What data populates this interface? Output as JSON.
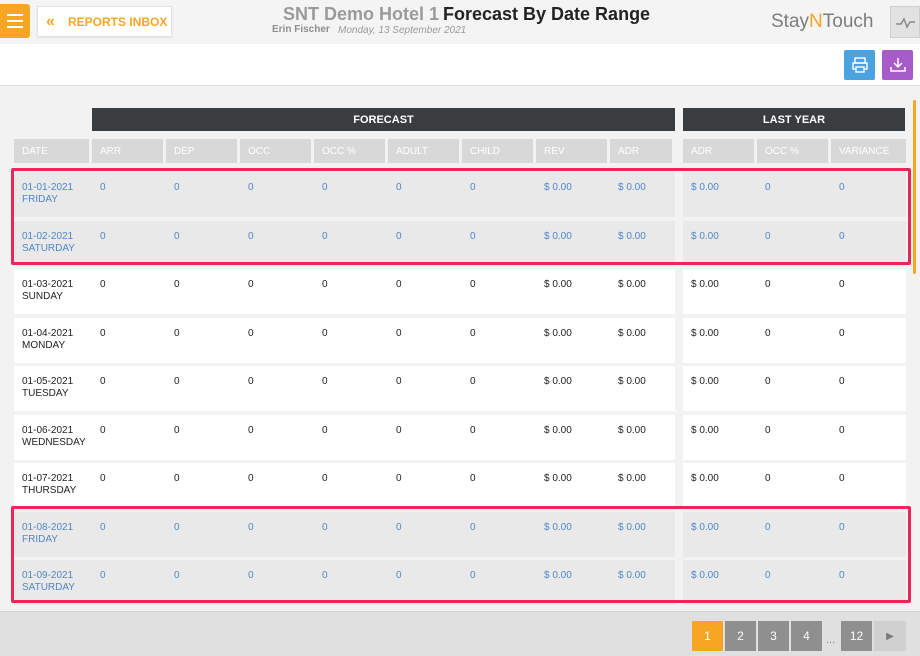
{
  "header": {
    "back_label": "REPORTS INBOX",
    "hotel_name": "SNT Demo Hotel 1",
    "report_title": "Forecast By Date Range",
    "user_name": "Erin Fischer",
    "date": "Monday, 13 September 2021",
    "logo_stay": "Stay",
    "logo_n": "N",
    "logo_touch": "Touch"
  },
  "groups": {
    "forecast": "FORECAST",
    "last_year": "LAST YEAR"
  },
  "columns": [
    "DATE",
    "ARR",
    "DEP",
    "OCC",
    "OCC %",
    "ADULT",
    "CHILD",
    "REV",
    "ADR",
    "ADR",
    "OCC %",
    "VARIANCE"
  ],
  "rows": [
    {
      "date": "01-01-2021",
      "day": "FRIDAY",
      "arr": "0",
      "dep": "0",
      "occ": "0",
      "occ_pct": "0",
      "adult": "0",
      "child": "0",
      "rev": "$ 0.00",
      "adr": "$ 0.00",
      "ly_adr": "$ 0.00",
      "ly_occ_pct": "0",
      "variance": "0"
    },
    {
      "date": "01-02-2021",
      "day": "SATURDAY",
      "arr": "0",
      "dep": "0",
      "occ": "0",
      "occ_pct": "0",
      "adult": "0",
      "child": "0",
      "rev": "$ 0.00",
      "adr": "$ 0.00",
      "ly_adr": "$ 0.00",
      "ly_occ_pct": "0",
      "variance": "0"
    },
    {
      "date": "01-03-2021",
      "day": "SUNDAY",
      "arr": "0",
      "dep": "0",
      "occ": "0",
      "occ_pct": "0",
      "adult": "0",
      "child": "0",
      "rev": "$ 0.00",
      "adr": "$ 0.00",
      "ly_adr": "$ 0.00",
      "ly_occ_pct": "0",
      "variance": "0"
    },
    {
      "date": "01-04-2021",
      "day": "MONDAY",
      "arr": "0",
      "dep": "0",
      "occ": "0",
      "occ_pct": "0",
      "adult": "0",
      "child": "0",
      "rev": "$ 0.00",
      "adr": "$ 0.00",
      "ly_adr": "$ 0.00",
      "ly_occ_pct": "0",
      "variance": "0"
    },
    {
      "date": "01-05-2021",
      "day": "TUESDAY",
      "arr": "0",
      "dep": "0",
      "occ": "0",
      "occ_pct": "0",
      "adult": "0",
      "child": "0",
      "rev": "$ 0.00",
      "adr": "$ 0.00",
      "ly_adr": "$ 0.00",
      "ly_occ_pct": "0",
      "variance": "0"
    },
    {
      "date": "01-06-2021",
      "day": "WEDNESDAY",
      "arr": "0",
      "dep": "0",
      "occ": "0",
      "occ_pct": "0",
      "adult": "0",
      "child": "0",
      "rev": "$ 0.00",
      "adr": "$ 0.00",
      "ly_adr": "$ 0.00",
      "ly_occ_pct": "0",
      "variance": "0"
    },
    {
      "date": "01-07-2021",
      "day": "THURSDAY",
      "arr": "0",
      "dep": "0",
      "occ": "0",
      "occ_pct": "0",
      "adult": "0",
      "child": "0",
      "rev": "$ 0.00",
      "adr": "$ 0.00",
      "ly_adr": "$ 0.00",
      "ly_occ_pct": "0",
      "variance": "0"
    },
    {
      "date": "01-08-2021",
      "day": "FRIDAY",
      "arr": "0",
      "dep": "0",
      "occ": "0",
      "occ_pct": "0",
      "adult": "0",
      "child": "0",
      "rev": "$ 0.00",
      "adr": "$ 0.00",
      "ly_adr": "$ 0.00",
      "ly_occ_pct": "0",
      "variance": "0"
    },
    {
      "date": "01-09-2021",
      "day": "SATURDAY",
      "arr": "0",
      "dep": "0",
      "occ": "0",
      "occ_pct": "0",
      "adult": "0",
      "child": "0",
      "rev": "$ 0.00",
      "adr": "$ 0.00",
      "ly_adr": "$ 0.00",
      "ly_occ_pct": "0",
      "variance": "0"
    }
  ],
  "pagination": {
    "pages": [
      "1",
      "2",
      "3",
      "4"
    ],
    "ellipsis": "...",
    "last_page": "12",
    "current": "1"
  },
  "icons": {
    "menu": "hamburger-icon",
    "back": "double-chevron-left-icon",
    "print": "print-icon",
    "download": "download-icon",
    "activity": "activity-icon",
    "next": "caret-right-icon"
  },
  "colors": {
    "accent": "#f6a623",
    "highlight_border": "#e8285a",
    "weekend_text": "#4f86c8",
    "print_button": "#4aa3e0",
    "download_button": "#a65bc8"
  }
}
